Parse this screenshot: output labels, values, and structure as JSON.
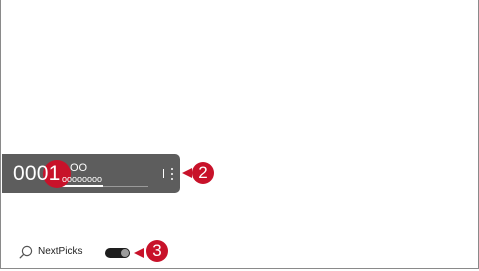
{
  "channel_banner": {
    "channel_number": "0001",
    "channel_name": "OO",
    "program_title": "oooooooo",
    "progress": 0.48
  },
  "callouts": {
    "more_options": "2",
    "nextpicks_toggle": "3"
  },
  "bottom_bar": {
    "search_label": "NextPicks",
    "toggle_on": true
  },
  "colors": {
    "banner_background": "#5d5d5d",
    "callout_red": "#c8122a",
    "toggle_track": "#1e1e1e",
    "toggle_knob": "#9c9c9c",
    "frame_border": "#8a8a8a"
  },
  "icons": {
    "more": "vertical-ellipsis-icon",
    "search": "search-icon"
  }
}
